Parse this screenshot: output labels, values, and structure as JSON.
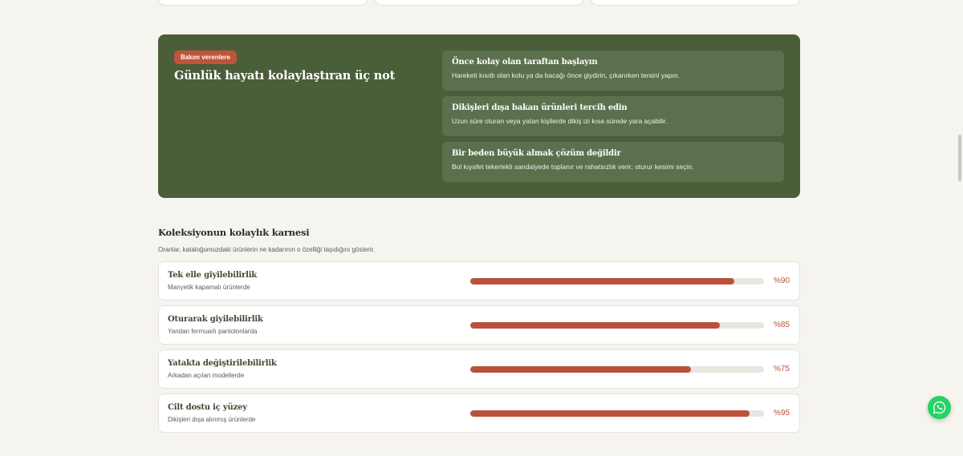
{
  "care": {
    "badge": "Bakım verenlere",
    "title": "Günlük hayatı kolaylaştıran üç not",
    "tips": [
      {
        "title": "Önce kolay olan taraftan başlayın",
        "text": "Hareketi kısıtlı olan kolu ya da bacağı önce giydirin, çıkarırken tersini yapın."
      },
      {
        "title": "Dikişleri dışa bakan ürünleri tercih edin",
        "text": "Uzun süre oturan veya yatan kişilerde dikiş izi kısa sürede yara açabilir."
      },
      {
        "title": "Bir beden büyük almak çözüm değildir",
        "text": "Bol kıyafet tekerlekli sandalyede toplanır ve rahatsızlık verir; oturur kesimi seçin."
      }
    ]
  },
  "scorecard": {
    "title": "Koleksiyonun kolaylık karnesi",
    "description": "Oranlar, kataloğumuzdaki ürünlerin ne kadarının o özelliği taşıdığını gösterir.",
    "metrics": [
      {
        "name": "Tek elle giyilebilirlik",
        "sub": "Manyetik kapamalı ürünlerde",
        "percent_label": "%90",
        "value": 90
      },
      {
        "name": "Oturarak giyilebilirlik",
        "sub": "Yandan fermuarlı pantolonlarda",
        "percent_label": "%85",
        "value": 85
      },
      {
        "name": "Yatakta değiştirilebilirlik",
        "sub": "Arkadan açılan modellerde",
        "percent_label": "%75",
        "value": 75
      },
      {
        "name": "Cilt dostu iç yüzey",
        "sub": "Dikişleri dışa alınmış ürünlerde",
        "percent_label": "%95",
        "value": 95
      }
    ]
  },
  "colors": {
    "panel_green": "#4a5e3a",
    "accent": "#b9513d",
    "whatsapp": "#25d366"
  },
  "icons": {
    "floating_button": "whatsapp-icon"
  }
}
